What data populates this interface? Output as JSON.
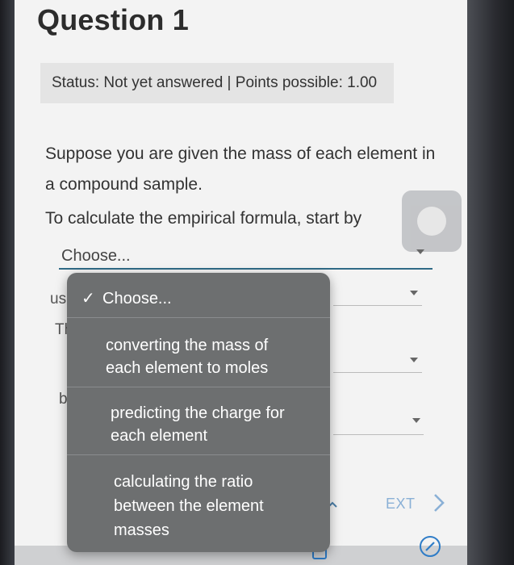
{
  "page": {
    "title": "Question 1",
    "status": "Status: Not yet answered | Points possible: 1.00"
  },
  "question": {
    "line1": "Suppose you are given the mass of each element in a compound sample.",
    "line2": "To calculate the empirical formula, start by"
  },
  "select1": {
    "value": "Choose..."
  },
  "underlay": {
    "frag1": "us",
    "frag2": "Th",
    "frag3": "by"
  },
  "dropdown": {
    "options": [
      {
        "label": "Choose...",
        "selected": true
      },
      {
        "label": "converting the mass of each element to moles",
        "selected": false
      },
      {
        "label": "predicting the charge for each element",
        "selected": false
      },
      {
        "label": "calculating the ratio between the element masses",
        "selected": false
      }
    ]
  },
  "nav": {
    "next_label": "EXT"
  },
  "colors": {
    "accent": "#2f6a86",
    "dropdown_bg": "#6d6f70",
    "next_link": "#8ab0d6"
  }
}
